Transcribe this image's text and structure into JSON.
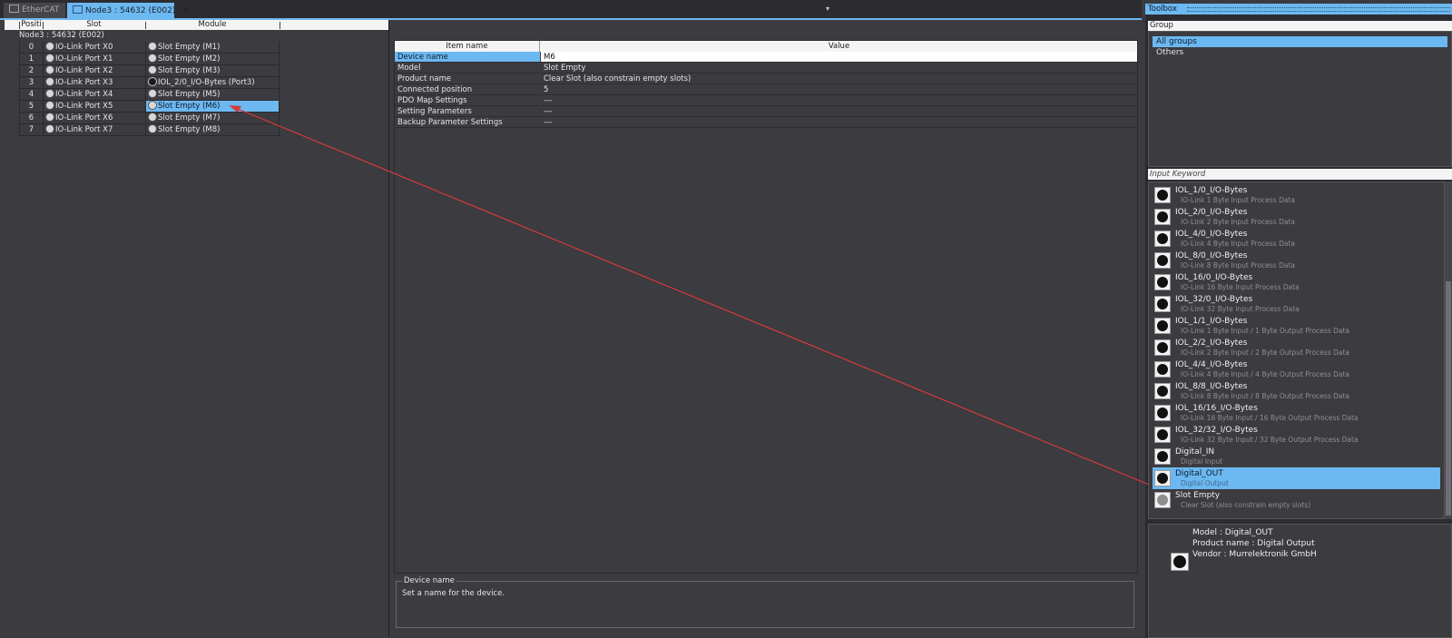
{
  "tabs": [
    {
      "label": "EtherCAT",
      "active": false
    },
    {
      "label": "Node3 : 54632 (E002)",
      "active": true,
      "close": "×"
    }
  ],
  "tab_dropdown": "▾",
  "slot_table": {
    "headers": {
      "position": "Positi",
      "slot": "Slot",
      "module": "Module"
    },
    "node_label": "Node3 : 54632 (E002)",
    "rows": [
      {
        "pos": "0",
        "slot": "IO-Link Port X0",
        "module": "Slot Empty (M1)"
      },
      {
        "pos": "1",
        "slot": "IO-Link Port X1",
        "module": "Slot Empty (M2)"
      },
      {
        "pos": "2",
        "slot": "IO-Link Port X2",
        "module": "Slot Empty (M3)"
      },
      {
        "pos": "3",
        "slot": "IO-Link Port X3",
        "module": "IOL_2/0_I/O-Bytes (Port3)"
      },
      {
        "pos": "4",
        "slot": "IO-Link Port X4",
        "module": "Slot Empty (M5)"
      },
      {
        "pos": "5",
        "slot": "IO-Link Port X5",
        "module": "Slot Empty (M6)"
      },
      {
        "pos": "6",
        "slot": "IO-Link Port X6",
        "module": "Slot Empty (M7)"
      },
      {
        "pos": "7",
        "slot": "IO-Link Port X7",
        "module": "Slot Empty (M8)"
      }
    ]
  },
  "properties": {
    "headers": {
      "name": "Item name",
      "value": "Value"
    },
    "rows": [
      {
        "name": "Device name",
        "value": "M6"
      },
      {
        "name": "Model",
        "value": "Slot Empty"
      },
      {
        "name": "Product name",
        "value": "Clear Slot (also constrain empty slots)"
      },
      {
        "name": "Connected position",
        "value": "5"
      },
      {
        "name": "PDO Map Settings",
        "value": "---"
      },
      {
        "name": "Setting Parameters",
        "value": "---"
      },
      {
        "name": "Backup Parameter Settings",
        "value": "---"
      }
    ]
  },
  "description": {
    "title": "Device name",
    "text": "Set a name for the device."
  },
  "toolbox": {
    "title": "Toolbox",
    "group_header": "Group",
    "groups": [
      "All groups",
      "Others"
    ],
    "keyword_placeholder": "Input Keyword",
    "modules": [
      {
        "name": "IOL_1/0_I/O-Bytes",
        "desc": "IO-Link 1 Byte Input Process Data"
      },
      {
        "name": "IOL_2/0_I/O-Bytes",
        "desc": "IO-Link 2 Byte Input Process Data"
      },
      {
        "name": "IOL_4/0_I/O-Bytes",
        "desc": "IO-Link 4 Byte Input Process Data"
      },
      {
        "name": "IOL_8/0_I/O-Bytes",
        "desc": "IO-Link 8 Byte Input Process Data"
      },
      {
        "name": "IOL_16/0_I/O-Bytes",
        "desc": "IO-Link 16 Byte Input Process Data"
      },
      {
        "name": "IOL_32/0_I/O-Bytes",
        "desc": "IO-Link 32 Byte Input Process Data"
      },
      {
        "name": "IOL_1/1_I/O-Bytes",
        "desc": "IO-Link 1 Byte Input / 1 Byte Output Process Data"
      },
      {
        "name": "IOL_2/2_I/O-Bytes",
        "desc": "IO-Link 2 Byte Input / 2 Byte Output Process Data"
      },
      {
        "name": "IOL_4/4_I/O-Bytes",
        "desc": "IO-Link 4 Byte Input / 4 Byte Output Process Data"
      },
      {
        "name": "IOL_8/8_I/O-Bytes",
        "desc": "IO-Link 8 Byte Input / 8 Byte Output Process Data"
      },
      {
        "name": "IOL_16/16_I/O-Bytes",
        "desc": "IO-Link 16 Byte Input / 16 Byte Output Process Data"
      },
      {
        "name": "IOL_32/32_I/O-Bytes",
        "desc": "IO-Link 32 Byte Input / 32 Byte Output Process Data"
      },
      {
        "name": "Digital_IN",
        "desc": "Digital Input"
      },
      {
        "name": "Digital_OUT",
        "desc": "Digital Output"
      },
      {
        "name": "Slot Empty",
        "desc": "Clear Slot (also constrain empty slots)"
      }
    ],
    "info": {
      "model": "Model : Digital_OUT",
      "product": "Product name : Digital Output",
      "vendor": "Vendor :  Murrelektronik GmbH"
    }
  },
  "colors": {
    "accent": "#6cb8f0",
    "panel": "#3b3b40",
    "annotation_arrow": "#d43a3a"
  }
}
